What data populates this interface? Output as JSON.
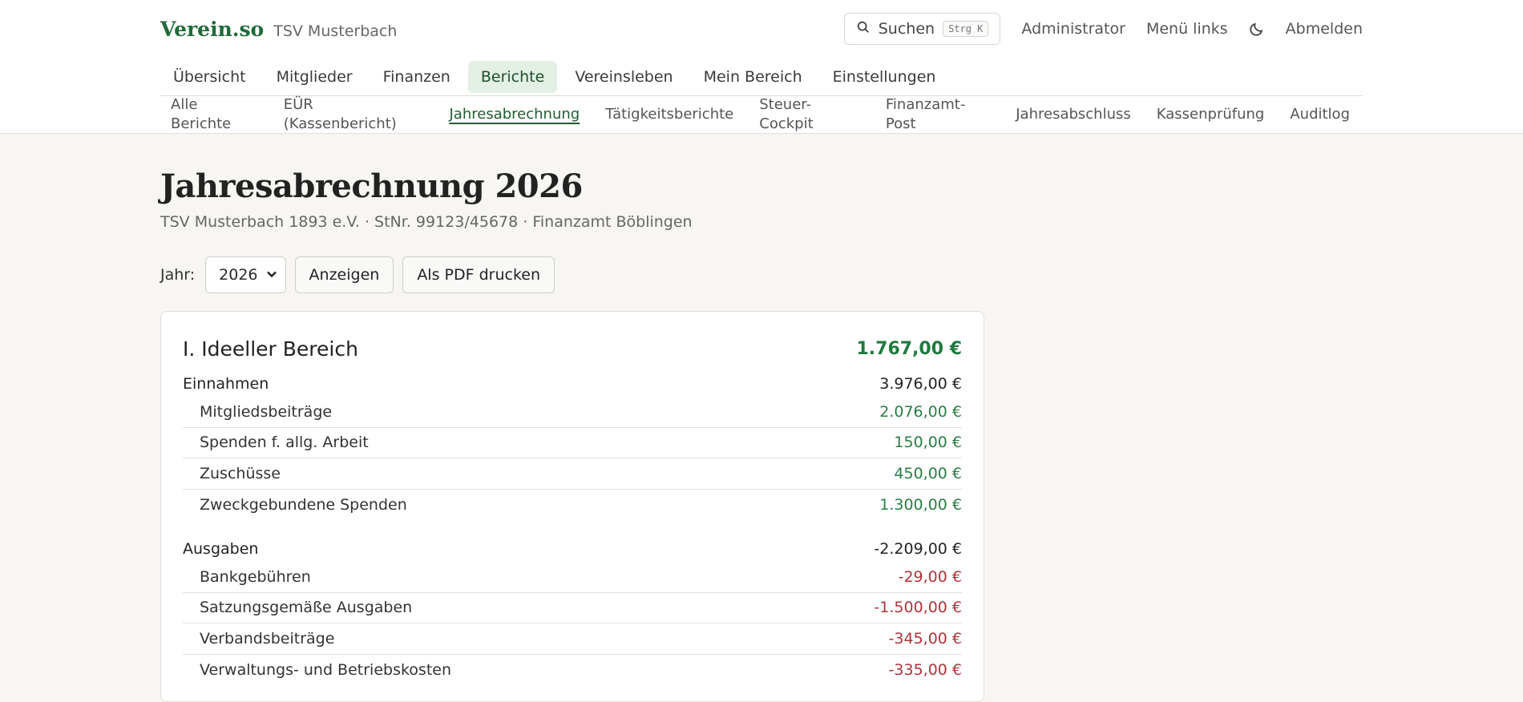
{
  "header": {
    "logo": "Verein.so",
    "club": "TSV Musterbach",
    "search_label": "Suchen",
    "search_shortcut": "Strg K",
    "user": "Administrator",
    "menu_toggle": "Menü links",
    "logout": "Abmelden"
  },
  "main_nav": [
    {
      "label": "Übersicht",
      "active": false
    },
    {
      "label": "Mitglieder",
      "active": false
    },
    {
      "label": "Finanzen",
      "active": false
    },
    {
      "label": "Berichte",
      "active": true
    },
    {
      "label": "Vereinsleben",
      "active": false
    },
    {
      "label": "Mein Bereich",
      "active": false
    },
    {
      "label": "Einstellungen",
      "active": false
    }
  ],
  "sub_nav": [
    {
      "label": "Alle Berichte",
      "active": false
    },
    {
      "label": "EÜR (Kassenbericht)",
      "active": false
    },
    {
      "label": "Jahresabrechnung",
      "active": true
    },
    {
      "label": "Tätigkeitsberichte",
      "active": false
    },
    {
      "label": "Steuer-Cockpit",
      "active": false
    },
    {
      "label": "Finanzamt-Post",
      "active": false
    },
    {
      "label": "Jahresabschluss",
      "active": false
    },
    {
      "label": "Kassenprüfung",
      "active": false
    },
    {
      "label": "Auditlog",
      "active": false
    }
  ],
  "page": {
    "title": "Jahresabrechnung 2026",
    "meta": "TSV Musterbach 1893 e.V. · StNr. 99123/45678 · Finanzamt Böblingen"
  },
  "controls": {
    "year_label": "Jahr:",
    "year_value": "2026",
    "show_button": "Anzeigen",
    "pdf_button": "Als PDF drucken"
  },
  "report": {
    "section_title": "I. Ideeller Bereich",
    "section_total": "1.767,00 €",
    "income": {
      "label": "Einnahmen",
      "total": "3.976,00 €",
      "lines": [
        {
          "label": "Mitgliedsbeiträge",
          "amount": "2.076,00 €"
        },
        {
          "label": "Spenden f. allg. Arbeit",
          "amount": "150,00 €"
        },
        {
          "label": "Zuschüsse",
          "amount": "450,00 €"
        },
        {
          "label": "Zweckgebundene Spenden",
          "amount": "1.300,00 €"
        }
      ]
    },
    "expenses": {
      "label": "Ausgaben",
      "total": "-2.209,00 €",
      "lines": [
        {
          "label": "Bankgebühren",
          "amount": "-29,00 €"
        },
        {
          "label": "Satzungsgemäße Ausgaben",
          "amount": "-1.500,00 €"
        },
        {
          "label": "Verbandsbeiträge",
          "amount": "-345,00 €"
        },
        {
          "label": "Verwaltungs- und Betriebskosten",
          "amount": "-335,00 €"
        }
      ]
    }
  },
  "colors": {
    "brand": "#1f6b3a",
    "positive": "#2a7d45",
    "negative": "#b1333a",
    "active_tab_bg": "#e4f0e6"
  }
}
